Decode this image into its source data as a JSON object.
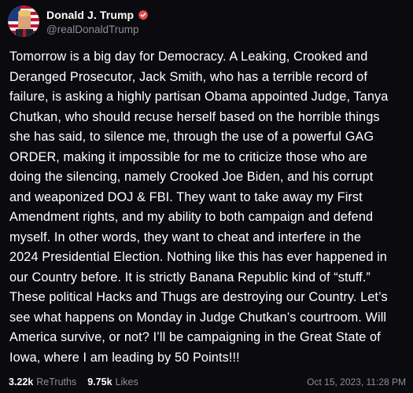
{
  "author": {
    "display_name": "Donald J. Trump",
    "handle": "@realDonaldTrump",
    "avatar_icon": "profile-avatar",
    "verified_icon": "verified-badge-icon",
    "verified_color": "#e5484d"
  },
  "post": {
    "lines": [
      "Tomorrow is a big day for Democracy. A Leaking, Crooked and",
      "Deranged Prosecutor, Jack Smith, who has a terrible record of",
      "failure, is asking a highly partisan Obama appointed Judge, Tanya",
      "Chutkan, who should recuse herself based on the horrible things",
      "she has said, to silence me, through the use of a powerful GAG",
      "ORDER, making it impossible for me to criticize those who are",
      "doing the silencing, namely Crooked Joe Biden, and his corrupt",
      "and weaponized DOJ & FBI. They want to take away my First",
      "Amendment rights, and my ability to both campaign and defend",
      "myself. In other words, they want to cheat and interfere in the",
      "2024 Presidential Election. Nothing like this has ever happened in",
      "our Country before. It is strictly Banana Republic kind of “stuff.”",
      "These political Hacks and Thugs are destroying our Country. Let’s",
      "see what happens on Monday in Judge Chutkan’s courtroom. Will",
      "America survive, or not? I’ll be campaigning in the Great State of",
      "Iowa, where I am leading by 50 Points!!!"
    ]
  },
  "stats": {
    "retruths_count": "3.22k",
    "retruths_label": "ReTruths",
    "likes_count": "9.75k",
    "likes_label": "Likes"
  },
  "timestamp": "Oct 15, 2023, 11:28 PM",
  "colors": {
    "background": "#0b0b0f",
    "text": "#ffffff",
    "muted": "#8c8d99"
  }
}
